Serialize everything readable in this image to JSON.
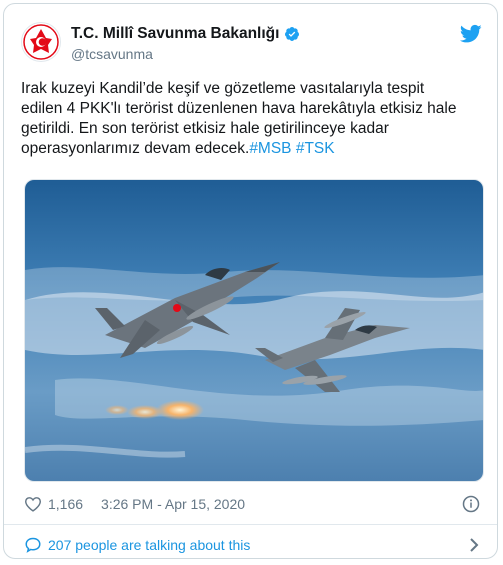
{
  "author": {
    "name": "T.C. Millî Savunma Bakanlığı",
    "handle": "@tcsavunma",
    "verified": true
  },
  "tweet": {
    "text": "Irak kuzeyi Kandil’de keşif ve gözetleme vasıtalarıyla tespit\nedilen 4 PKK'lı terörist düzenlenen hava harekâtıyla etkisiz hale\ngetirildi. En son terörist etkisiz hale getirilinceye kadar\noperasyonlarımız devam edecek.",
    "hashtags": [
      "#MSB",
      "#TSK"
    ]
  },
  "media": {
    "icons": [
      "fighter-jet-icon",
      "fighter-jet-icon"
    ]
  },
  "stats": {
    "likes": "1,166",
    "timestamp": "3:26 PM - Apr 15, 2020"
  },
  "talking": {
    "label": "207 people are talking about this"
  },
  "colors": {
    "link": "#1b95e0",
    "muted": "#657786",
    "text": "#14171a",
    "brand_red": "#e30a17"
  }
}
